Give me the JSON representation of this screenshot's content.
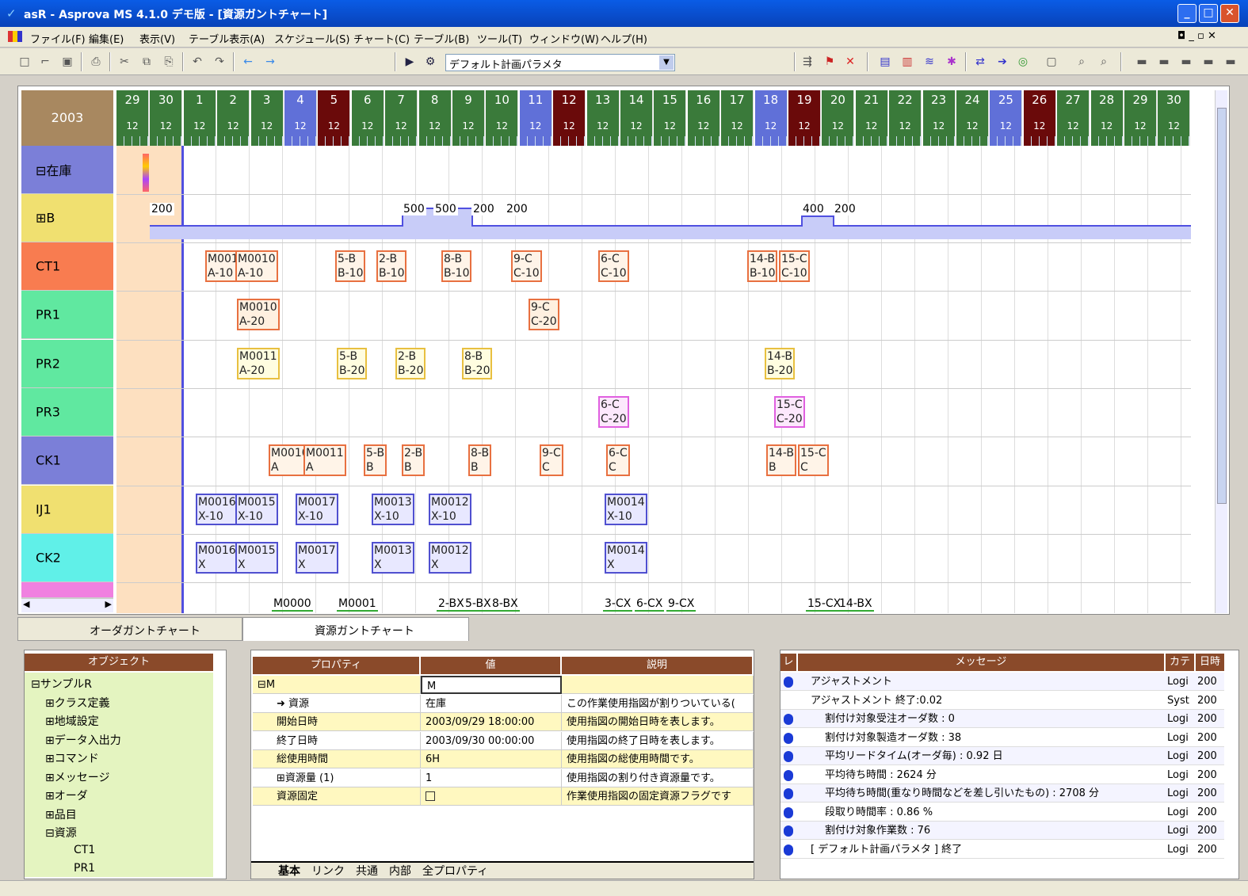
{
  "window": {
    "title": "asR - Asprova MS 4.1.0 デモ版 - [資源ガントチャート]"
  },
  "menu": [
    "ファイル(F)",
    "編集(E)",
    "表示(V)",
    "テーブル表示(A)",
    "スケジュール(S)",
    "チャート(C)",
    "テーブル(B)",
    "ツール(T)",
    "ウィンドウ(W)",
    "ヘルプ(H)"
  ],
  "toolbar": {
    "param_label": "デフォルト計画パラメタ"
  },
  "gantt": {
    "year": "2003",
    "days": [
      {
        "n": "29",
        "h": "12",
        "t": "w"
      },
      {
        "n": "30",
        "h": "12",
        "t": "w"
      },
      {
        "n": "1",
        "h": "12",
        "t": "w"
      },
      {
        "n": "2",
        "h": "12",
        "t": "w"
      },
      {
        "n": "3",
        "h": "12",
        "t": "w"
      },
      {
        "n": "4",
        "h": "12",
        "t": "sat"
      },
      {
        "n": "5",
        "h": "12",
        "t": "sun"
      },
      {
        "n": "6",
        "h": "12",
        "t": "w"
      },
      {
        "n": "7",
        "h": "12",
        "t": "w"
      },
      {
        "n": "8",
        "h": "12",
        "t": "w"
      },
      {
        "n": "9",
        "h": "12",
        "t": "w"
      },
      {
        "n": "10",
        "h": "12",
        "t": "w"
      },
      {
        "n": "11",
        "h": "12",
        "t": "sat"
      },
      {
        "n": "12",
        "h": "12",
        "t": "sun"
      },
      {
        "n": "13",
        "h": "12",
        "t": "w"
      },
      {
        "n": "14",
        "h": "12",
        "t": "w"
      },
      {
        "n": "15",
        "h": "12",
        "t": "w"
      },
      {
        "n": "16",
        "h": "12",
        "t": "w"
      },
      {
        "n": "17",
        "h": "12",
        "t": "w"
      },
      {
        "n": "18",
        "h": "12",
        "t": "sat"
      },
      {
        "n": "19",
        "h": "12",
        "t": "sun"
      },
      {
        "n": "20",
        "h": "12",
        "t": "w"
      },
      {
        "n": "21",
        "h": "12",
        "t": "w"
      },
      {
        "n": "22",
        "h": "12",
        "t": "w"
      },
      {
        "n": "23",
        "h": "12",
        "t": "w"
      },
      {
        "n": "24",
        "h": "12",
        "t": "w"
      },
      {
        "n": "25",
        "h": "12",
        "t": "sat"
      },
      {
        "n": "26",
        "h": "12",
        "t": "sun"
      },
      {
        "n": "27",
        "h": "12",
        "t": "w"
      },
      {
        "n": "28",
        "h": "12",
        "t": "w"
      },
      {
        "n": "29",
        "h": "12",
        "t": "w"
      },
      {
        "n": "30",
        "h": "12",
        "t": "w"
      }
    ],
    "resources": [
      {
        "label": "⊟在庫",
        "color": "#7b7fd8"
      },
      {
        "label": "⊞B",
        "color": "#f0e070"
      },
      {
        "label": "CT1",
        "color": "#f87c50"
      },
      {
        "label": "PR1",
        "color": "#60e8a0"
      },
      {
        "label": "PR2",
        "color": "#60e8a0"
      },
      {
        "label": "PR3",
        "color": "#60e8a0"
      },
      {
        "label": "CK1",
        "color": "#7b7fd8"
      },
      {
        "label": "IJ1",
        "color": "#f0e070"
      },
      {
        "label": "CK2",
        "color": "#60f0e8"
      }
    ],
    "inventory": [
      "200",
      "500",
      "500",
      "200",
      "200",
      "400",
      "200"
    ],
    "ops": {
      "ct1": [
        [
          "M0010",
          "A-10"
        ],
        [
          "M0010",
          "A-10"
        ],
        [
          "5-B",
          "B-10"
        ],
        [
          "2-B",
          "B-10"
        ],
        [
          "8-B",
          "B-10"
        ],
        [
          "9-C",
          "C-10"
        ],
        [
          "6-C",
          "C-10"
        ],
        [
          "14-B",
          "B-10"
        ],
        [
          "15-C",
          "C-10"
        ]
      ],
      "pr1": [
        [
          "M0010",
          "A-20"
        ],
        [
          "9-C",
          "C-20"
        ]
      ],
      "pr2": [
        [
          "M0011",
          "A-20"
        ],
        [
          "5-B",
          "B-20"
        ],
        [
          "2-B",
          "B-20"
        ],
        [
          "8-B",
          "B-20"
        ],
        [
          "14-B",
          "B-20"
        ]
      ],
      "pr3": [
        [
          "6-C",
          "C-20"
        ],
        [
          "15-C",
          "C-20"
        ]
      ],
      "ck1": [
        [
          "M0010",
          "A"
        ],
        [
          "M0011",
          "A"
        ],
        [
          "5-B",
          "B"
        ],
        [
          "2-B",
          "B"
        ],
        [
          "8-B",
          "B"
        ],
        [
          "9-C",
          "C"
        ],
        [
          "6-C",
          "C"
        ],
        [
          "14-B",
          "B"
        ],
        [
          "15-C",
          "C"
        ]
      ],
      "ij1": [
        [
          "M0016",
          "X-10"
        ],
        [
          "M0015",
          "X-10"
        ],
        [
          "M0017",
          "X-10"
        ],
        [
          "M0013",
          "X-10"
        ],
        [
          "M0012",
          "X-10"
        ],
        [
          "M0014",
          "X-10"
        ]
      ],
      "ck2": [
        [
          "M0016",
          "X"
        ],
        [
          "M0015",
          "X"
        ],
        [
          "M0017",
          "X"
        ],
        [
          "M0013",
          "X"
        ],
        [
          "M0012",
          "X"
        ],
        [
          "M0014",
          "X"
        ]
      ],
      "last": [
        "M0000",
        "M0001",
        "2-BX",
        "5-BX",
        "8-BX",
        "3-CX",
        "6-CX",
        "9-CX",
        "15-CX",
        "14-BX"
      ]
    }
  },
  "tabs": [
    "オーダガントチャート",
    "資源ガントチャート"
  ],
  "objects": {
    "header": "オブジェクト",
    "items": [
      "⊟サンプルR",
      "⊞クラス定義",
      "⊞地域設定",
      "⊞データ入出力",
      "⊞コマンド",
      "⊞メッセージ",
      "⊞オーダ",
      "⊞品目",
      "⊟資源",
      "CT1",
      "PR1"
    ]
  },
  "properties": {
    "headers": [
      "プロパティ",
      "値",
      "説明"
    ],
    "rows": [
      [
        "⊟M",
        "M",
        ""
      ],
      [
        "➜ 資源",
        "在庫",
        "この作業使用指図が割りついている("
      ],
      [
        "開始日時",
        "2003/09/29 18:00:00",
        "使用指図の開始日時を表します。"
      ],
      [
        "終了日時",
        "2003/09/30 00:00:00",
        "使用指図の終了日時を表します。"
      ],
      [
        "総使用時間",
        "6H",
        "使用指図の総使用時間です。"
      ],
      [
        "⊞資源量 (1)",
        "1",
        "使用指図の割り付き資源量です。"
      ],
      [
        "資源固定",
        "",
        "作業使用指図の固定資源フラグです"
      ]
    ],
    "tabs": [
      "基本",
      "リンク",
      "共通",
      "内部",
      "全プロパティ"
    ]
  },
  "messages": {
    "headers": [
      "レ",
      "メッセージ",
      "カテ",
      "日時"
    ],
    "rows": [
      [
        "アジャストメント",
        "Logi",
        "200",
        true
      ],
      [
        "アジャストメント 終了:0.02",
        "Syst",
        "200",
        false
      ],
      [
        "割付け対象受注オーダ数 : 0",
        "Logi",
        "200",
        true
      ],
      [
        "割付け対象製造オーダ数 : 38",
        "Logi",
        "200",
        true
      ],
      [
        "平均リードタイム(オーダ毎) : 0.92 日",
        "Logi",
        "200",
        true
      ],
      [
        "平均待ち時間 : 2624 分",
        "Logi",
        "200",
        true
      ],
      [
        "平均待ち時間(重なり時間などを差し引いたもの) : 2708 分",
        "Logi",
        "200",
        true
      ],
      [
        "段取り時間率 : 0.86 %",
        "Logi",
        "200",
        true
      ],
      [
        "割付け対象作業数 : 76",
        "Logi",
        "200",
        true
      ],
      [
        "[ デフォルト計画パラメタ ] 終了",
        "Logi",
        "200",
        true
      ]
    ]
  },
  "colors": {
    "titlebar": "#0a5ce6",
    "weekday": "#3a7a3a",
    "saturday": "#6070d8",
    "sunday": "#6a0a0a"
  }
}
